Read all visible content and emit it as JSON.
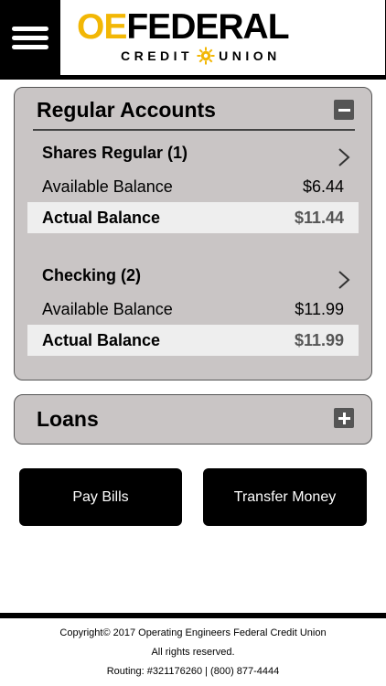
{
  "header": {
    "logo_primary_a": "OE",
    "logo_primary_b": "FEDERAL",
    "logo_secondary_a": "CREDIT",
    "logo_secondary_b": "UNION",
    "accent_color": "#f2b705"
  },
  "regular_accounts": {
    "title": "Regular Accounts",
    "toggle_icon": "minus-icon",
    "accounts": [
      {
        "name": "Shares Regular (1)",
        "available_label": "Available Balance",
        "available_amount": "$6.44",
        "actual_label": "Actual Balance",
        "actual_amount": "$11.44"
      },
      {
        "name": "Checking (2)",
        "available_label": "Available Balance",
        "available_amount": "$11.99",
        "actual_label": "Actual Balance",
        "actual_amount": "$11.99"
      }
    ]
  },
  "loans": {
    "title": "Loans",
    "toggle_icon": "plus-icon"
  },
  "actions": {
    "pay_bills": "Pay Bills",
    "transfer_money": "Transfer Money"
  },
  "footer": {
    "copyright": "Copyright© 2017 Operating Engineers Federal Credit Union",
    "rights": "All rights reserved.",
    "routing": "Routing: #321176260 | (800) 877-4444"
  }
}
